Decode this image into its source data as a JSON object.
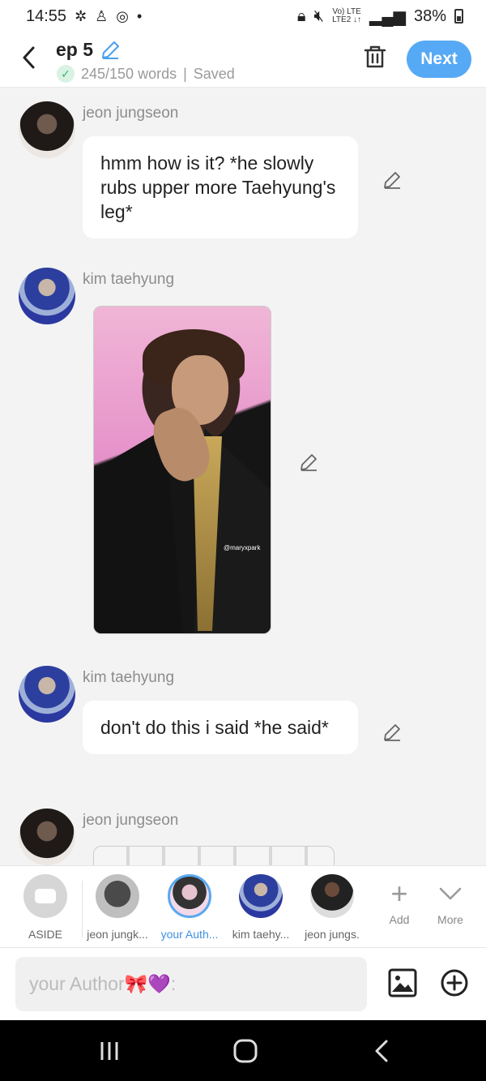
{
  "status_bar": {
    "time": "14:55",
    "network_top": "Vo) LTE",
    "network_bottom": "LTE2 ↓↑",
    "battery": "38%"
  },
  "header": {
    "title": "ep 5",
    "word_count": "245/150 words",
    "save_status": "Saved",
    "next_label": "Next"
  },
  "messages": [
    {
      "sender": "jeon jungseon",
      "type": "text",
      "text": "hmm how is it? *he slowly rubs upper more Taehyung's leg*"
    },
    {
      "sender": "kim taehyung",
      "type": "image",
      "watermark": "@maryxpark"
    },
    {
      "sender": "kim taehyung",
      "type": "text",
      "text": "don't do this i said *he said*"
    },
    {
      "sender": "jeon jungseon",
      "type": "image"
    }
  ],
  "characters": [
    {
      "label": "ASIDE"
    },
    {
      "label": "jeon jungk..."
    },
    {
      "label": "your Auth..."
    },
    {
      "label": "kim taehy..."
    },
    {
      "label": "jeon jungs."
    }
  ],
  "controls": {
    "add_label": "Add",
    "more_label": "More"
  },
  "composer": {
    "placeholder": "your Author🎀💜:"
  },
  "colors": {
    "accent": "#56a9f5",
    "selected_label": "#3f8fe0"
  }
}
